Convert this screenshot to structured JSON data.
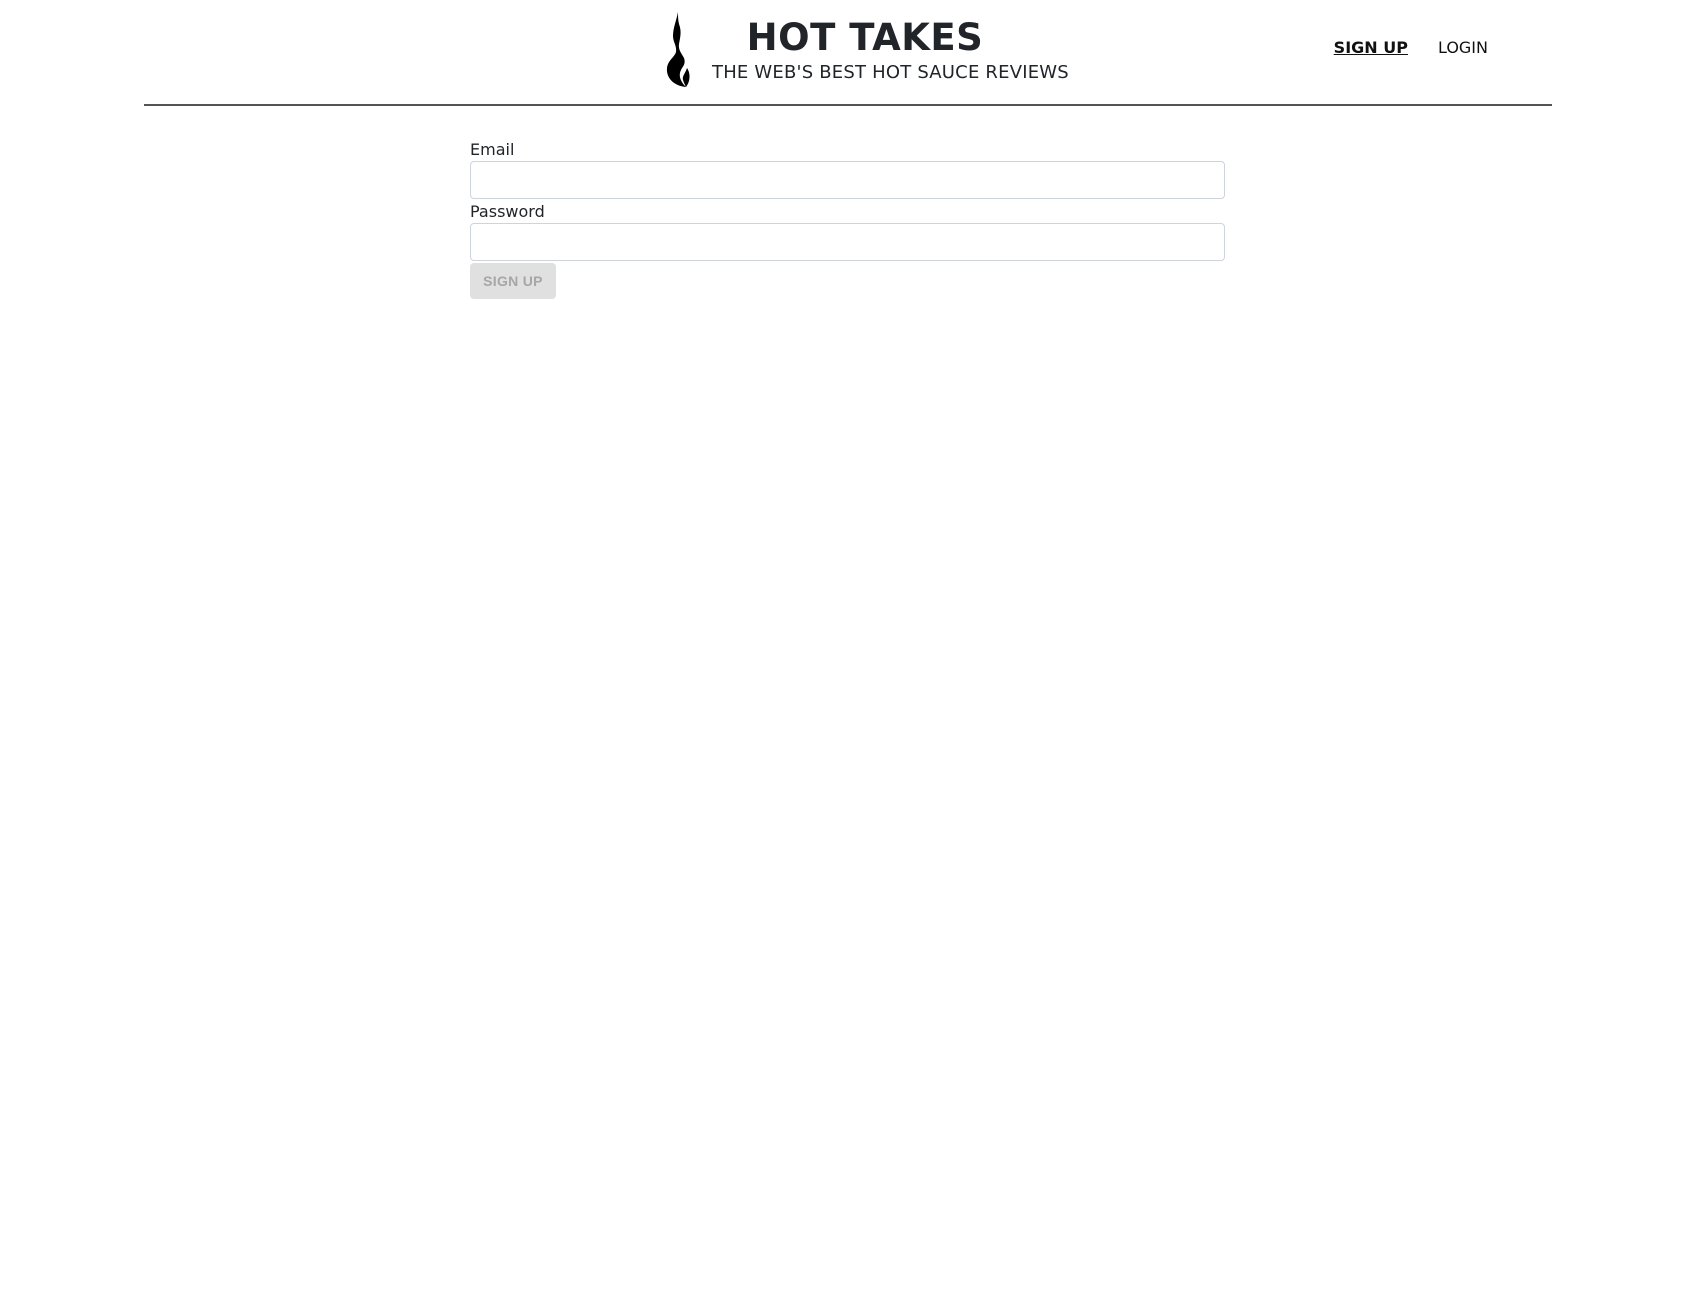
{
  "header": {
    "title": "HOT TAKES",
    "subtitle": "THE WEB'S BEST HOT SAUCE REVIEWS",
    "logo_icon": "flame-icon"
  },
  "nav": {
    "signup_label": "SIGN UP",
    "login_label": "LOGIN",
    "active": "signup"
  },
  "form": {
    "email_label": "Email",
    "email_value": "",
    "password_label": "Password",
    "password_value": "",
    "submit_label": "SIGN UP",
    "submit_disabled": true
  },
  "colors": {
    "text": "#212529",
    "divider": "#555555",
    "button_disabled_bg": "#e0e0e0",
    "button_disabled_text": "#a6a6a6"
  }
}
